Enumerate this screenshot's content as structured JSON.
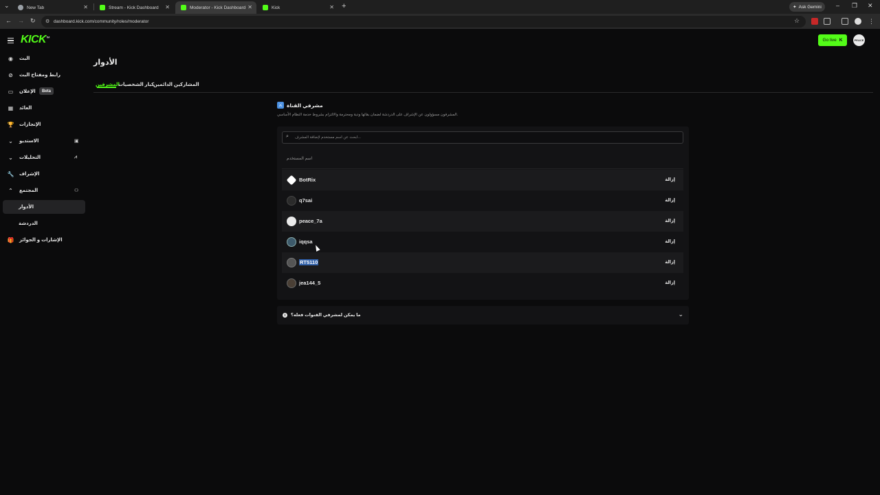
{
  "browser": {
    "tabs": [
      {
        "label": "New Tab",
        "active": false
      },
      {
        "label": "Stream - Kick Dashboard",
        "active": false
      },
      {
        "label": "Moderator - Kick Dashboard",
        "active": true
      },
      {
        "label": "Kick",
        "active": false
      }
    ],
    "gemini_label": "Ask Gemini",
    "url": "dashboard.kick.com/community/roles/moderator",
    "colors": {
      "kick_green": "#53fc18",
      "selection_blue": "#2f5fa8"
    }
  },
  "header": {
    "logo": "KICK",
    "logo_tm": "TM",
    "go_live": "Go live",
    "avatar_text": "PEACE"
  },
  "sidebar": {
    "items": [
      {
        "label": "البث",
        "icon": "broadcast-icon"
      },
      {
        "label": "رابط ومفتاح البث",
        "icon": "link-icon"
      },
      {
        "label": "الإعلان",
        "icon": "ad-icon",
        "badge": "Beta"
      },
      {
        "label": "العائد",
        "icon": "revenue-icon"
      },
      {
        "label": "الإنجازات",
        "icon": "trophy-icon"
      },
      {
        "label": "الاستديو",
        "icon": "chevron-down-icon"
      },
      {
        "label": "التحليلات",
        "icon": "chevron-down-icon"
      },
      {
        "label": "الإشراف",
        "icon": "wrench-icon"
      },
      {
        "label": "المجتمع",
        "icon": "chevron-up-icon"
      },
      {
        "label": "الأدوار",
        "icon": "",
        "active": true
      },
      {
        "label": "الدردشة",
        "icon": ""
      },
      {
        "label": "الإشارات و الجوائز",
        "icon": "gift-icon"
      }
    ]
  },
  "page": {
    "title": "الأدوار",
    "tabs": [
      {
        "label": "المشرفين",
        "active": true
      },
      {
        "label": "كبار الشخصيات",
        "active": false
      },
      {
        "label": "المشاركين الدائمين",
        "active": false
      }
    ]
  },
  "moderators": {
    "title": "مشرفي القناة",
    "description": "المشرفون مسؤولون عن الإشراف على الدردشة لضمان بقائها ودية ومحترمة والالتزام بشروط خدمة النظام الأساسي.",
    "search_placeholder": "ابحث عن اسم مستخدم لإضافة المشرف...",
    "column_header": "اسم المستخدم",
    "remove_label": "إزالة",
    "rows": [
      {
        "username": "BotRix"
      },
      {
        "username": "q7sai"
      },
      {
        "username": "peace_7a"
      },
      {
        "username": "iqqsa"
      },
      {
        "username": "RT5110",
        "selected": true
      },
      {
        "username": "jea144_5"
      }
    ]
  },
  "faq": {
    "question": "ما يمكن لمشرفي القنوات فعله؟"
  }
}
